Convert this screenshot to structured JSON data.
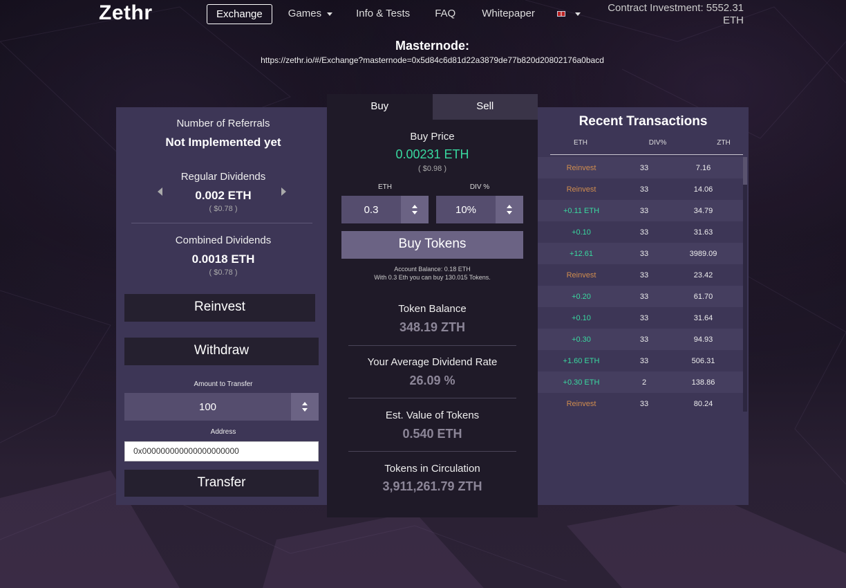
{
  "brand": "Zethr",
  "nav": {
    "items": [
      "Exchange",
      "Games",
      "Info & Tests",
      "FAQ",
      "Whitepaper"
    ],
    "active": "Exchange",
    "language_icon": "uk-flag-icon"
  },
  "contract": {
    "label": "Contract Investment: 5552.31",
    "unit": "ETH"
  },
  "masternode": {
    "title": "Masternode:",
    "url": "https://zethr.io/#/Exchange?masternode=0x5d84c6d81d22a3879de77b820d20802176a0bacd"
  },
  "left": {
    "referrals_label": "Number of Referrals",
    "referrals_value": "Not Implemented yet",
    "regular_label": "Regular Dividends",
    "regular_value": "0.002 ETH",
    "regular_usd": "( $0.78 )",
    "combined_label": "Combined Dividends",
    "combined_value": "0.0018 ETH",
    "combined_usd": "( $0.78 )",
    "reinvest": "Reinvest",
    "withdraw": "Withdraw",
    "transfer_amount_label": "Amount to Transfer",
    "transfer_amount": "100",
    "address_label": "Address",
    "address": "0x000000000000000000000",
    "transfer": "Transfer"
  },
  "center": {
    "tabs": [
      "Buy",
      "Sell"
    ],
    "buy_price_label": "Buy Price",
    "buy_price": "0.00231 ETH",
    "buy_price_usd": "( $0.98 )",
    "eth_label": "ETH",
    "eth_value": "0.3",
    "div_label": "DIV %",
    "div_value": "10%",
    "buy_button": "Buy Tokens",
    "account_balance": "Account Balance: 0.18 ETH",
    "can_buy": "With 0.3 Eth you can buy 130.015 Tokens.",
    "token_balance_label": "Token Balance",
    "token_balance": "348.19 ZTH",
    "avg_div_label": "Your Average Dividend Rate",
    "avg_div": "26.09 %",
    "est_value_label": "Est. Value of Tokens",
    "est_value": "0.540 ETH",
    "circulation_label": "Tokens in Circulation",
    "circulation": "3,911,261.79 ZTH"
  },
  "recent": {
    "title": "Recent Transactions",
    "columns": [
      "ETH",
      "DIV%",
      "ZTH"
    ],
    "rows": [
      {
        "eth": "Reinvest",
        "div": "33",
        "zth": "7.16"
      },
      {
        "eth": "Reinvest",
        "div": "33",
        "zth": "14.06"
      },
      {
        "eth": "+0.11 ETH",
        "div": "33",
        "zth": "34.79"
      },
      {
        "eth": "+0.10",
        "div": "33",
        "zth": "31.63"
      },
      {
        "eth": "+12.61",
        "div": "33",
        "zth": "3989.09"
      },
      {
        "eth": "Reinvest",
        "div": "33",
        "zth": "23.42"
      },
      {
        "eth": "+0.20",
        "div": "33",
        "zth": "61.70"
      },
      {
        "eth": "+0.10",
        "div": "33",
        "zth": "31.64"
      },
      {
        "eth": "+0.30",
        "div": "33",
        "zth": "94.93"
      },
      {
        "eth": "+1.60 ETH",
        "div": "33",
        "zth": "506.31"
      },
      {
        "eth": "+0.30 ETH",
        "div": "2",
        "zth": "138.86"
      },
      {
        "eth": "Reinvest",
        "div": "33",
        "zth": "80.24"
      }
    ]
  },
  "colors": {
    "accent_green": "#39d9a0",
    "reinvest_orange": "#d08d4e",
    "panel": "#3d3656",
    "center_panel": "#1f1a28"
  }
}
